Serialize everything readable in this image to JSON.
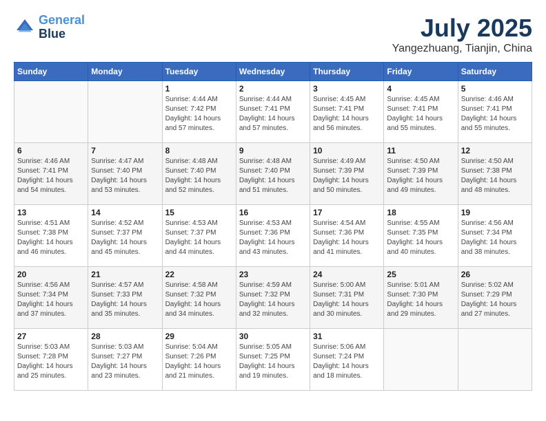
{
  "header": {
    "logo_line1": "General",
    "logo_line2": "Blue",
    "month": "July 2025",
    "location": "Yangezhuang, Tianjin, China"
  },
  "weekdays": [
    "Sunday",
    "Monday",
    "Tuesday",
    "Wednesday",
    "Thursday",
    "Friday",
    "Saturday"
  ],
  "weeks": [
    [
      {
        "day": "",
        "info": ""
      },
      {
        "day": "",
        "info": ""
      },
      {
        "day": "1",
        "info": "Sunrise: 4:44 AM\nSunset: 7:42 PM\nDaylight: 14 hours and 57 minutes."
      },
      {
        "day": "2",
        "info": "Sunrise: 4:44 AM\nSunset: 7:41 PM\nDaylight: 14 hours and 57 minutes."
      },
      {
        "day": "3",
        "info": "Sunrise: 4:45 AM\nSunset: 7:41 PM\nDaylight: 14 hours and 56 minutes."
      },
      {
        "day": "4",
        "info": "Sunrise: 4:45 AM\nSunset: 7:41 PM\nDaylight: 14 hours and 55 minutes."
      },
      {
        "day": "5",
        "info": "Sunrise: 4:46 AM\nSunset: 7:41 PM\nDaylight: 14 hours and 55 minutes."
      }
    ],
    [
      {
        "day": "6",
        "info": "Sunrise: 4:46 AM\nSunset: 7:41 PM\nDaylight: 14 hours and 54 minutes."
      },
      {
        "day": "7",
        "info": "Sunrise: 4:47 AM\nSunset: 7:40 PM\nDaylight: 14 hours and 53 minutes."
      },
      {
        "day": "8",
        "info": "Sunrise: 4:48 AM\nSunset: 7:40 PM\nDaylight: 14 hours and 52 minutes."
      },
      {
        "day": "9",
        "info": "Sunrise: 4:48 AM\nSunset: 7:40 PM\nDaylight: 14 hours and 51 minutes."
      },
      {
        "day": "10",
        "info": "Sunrise: 4:49 AM\nSunset: 7:39 PM\nDaylight: 14 hours and 50 minutes."
      },
      {
        "day": "11",
        "info": "Sunrise: 4:50 AM\nSunset: 7:39 PM\nDaylight: 14 hours and 49 minutes."
      },
      {
        "day": "12",
        "info": "Sunrise: 4:50 AM\nSunset: 7:38 PM\nDaylight: 14 hours and 48 minutes."
      }
    ],
    [
      {
        "day": "13",
        "info": "Sunrise: 4:51 AM\nSunset: 7:38 PM\nDaylight: 14 hours and 46 minutes."
      },
      {
        "day": "14",
        "info": "Sunrise: 4:52 AM\nSunset: 7:37 PM\nDaylight: 14 hours and 45 minutes."
      },
      {
        "day": "15",
        "info": "Sunrise: 4:53 AM\nSunset: 7:37 PM\nDaylight: 14 hours and 44 minutes."
      },
      {
        "day": "16",
        "info": "Sunrise: 4:53 AM\nSunset: 7:36 PM\nDaylight: 14 hours and 43 minutes."
      },
      {
        "day": "17",
        "info": "Sunrise: 4:54 AM\nSunset: 7:36 PM\nDaylight: 14 hours and 41 minutes."
      },
      {
        "day": "18",
        "info": "Sunrise: 4:55 AM\nSunset: 7:35 PM\nDaylight: 14 hours and 40 minutes."
      },
      {
        "day": "19",
        "info": "Sunrise: 4:56 AM\nSunset: 7:34 PM\nDaylight: 14 hours and 38 minutes."
      }
    ],
    [
      {
        "day": "20",
        "info": "Sunrise: 4:56 AM\nSunset: 7:34 PM\nDaylight: 14 hours and 37 minutes."
      },
      {
        "day": "21",
        "info": "Sunrise: 4:57 AM\nSunset: 7:33 PM\nDaylight: 14 hours and 35 minutes."
      },
      {
        "day": "22",
        "info": "Sunrise: 4:58 AM\nSunset: 7:32 PM\nDaylight: 14 hours and 34 minutes."
      },
      {
        "day": "23",
        "info": "Sunrise: 4:59 AM\nSunset: 7:32 PM\nDaylight: 14 hours and 32 minutes."
      },
      {
        "day": "24",
        "info": "Sunrise: 5:00 AM\nSunset: 7:31 PM\nDaylight: 14 hours and 30 minutes."
      },
      {
        "day": "25",
        "info": "Sunrise: 5:01 AM\nSunset: 7:30 PM\nDaylight: 14 hours and 29 minutes."
      },
      {
        "day": "26",
        "info": "Sunrise: 5:02 AM\nSunset: 7:29 PM\nDaylight: 14 hours and 27 minutes."
      }
    ],
    [
      {
        "day": "27",
        "info": "Sunrise: 5:03 AM\nSunset: 7:28 PM\nDaylight: 14 hours and 25 minutes."
      },
      {
        "day": "28",
        "info": "Sunrise: 5:03 AM\nSunset: 7:27 PM\nDaylight: 14 hours and 23 minutes."
      },
      {
        "day": "29",
        "info": "Sunrise: 5:04 AM\nSunset: 7:26 PM\nDaylight: 14 hours and 21 minutes."
      },
      {
        "day": "30",
        "info": "Sunrise: 5:05 AM\nSunset: 7:25 PM\nDaylight: 14 hours and 19 minutes."
      },
      {
        "day": "31",
        "info": "Sunrise: 5:06 AM\nSunset: 7:24 PM\nDaylight: 14 hours and 18 minutes."
      },
      {
        "day": "",
        "info": ""
      },
      {
        "day": "",
        "info": ""
      }
    ]
  ]
}
